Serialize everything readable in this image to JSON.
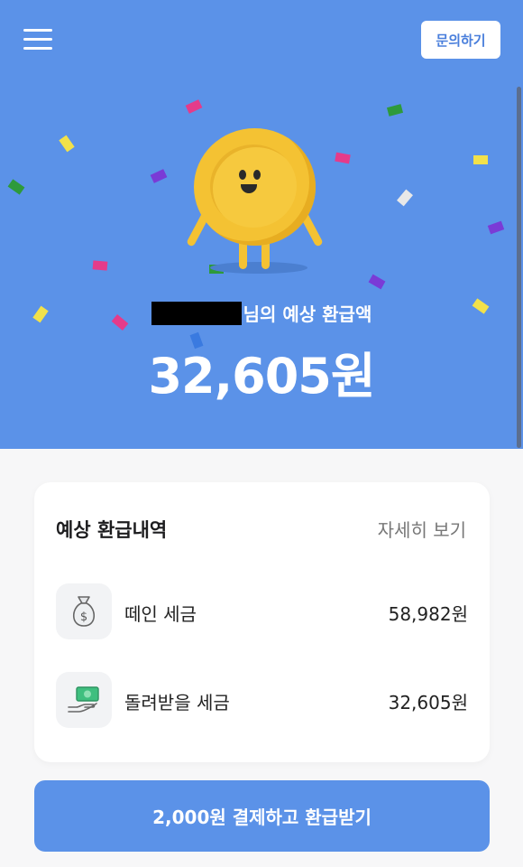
{
  "header": {
    "menu_icon": "hamburger-menu-icon",
    "inquiry_label": "문의하기"
  },
  "hero": {
    "name_suffix": "님의 예상 환급액",
    "amount": "32,605원",
    "colors": {
      "background": "#5b92e8",
      "coin": "#f4c233"
    }
  },
  "refund_details": {
    "title": "예상 환급내역",
    "detail_link": "자세히 보기",
    "rows": [
      {
        "label": "떼인 세금",
        "value": "58,982원",
        "icon": "money-bag-icon"
      },
      {
        "label": "돌려받을 세금",
        "value": "32,605원",
        "icon": "cash-hand-icon"
      }
    ]
  },
  "cta": {
    "label": "2,000원 결제하고 환급받기"
  }
}
